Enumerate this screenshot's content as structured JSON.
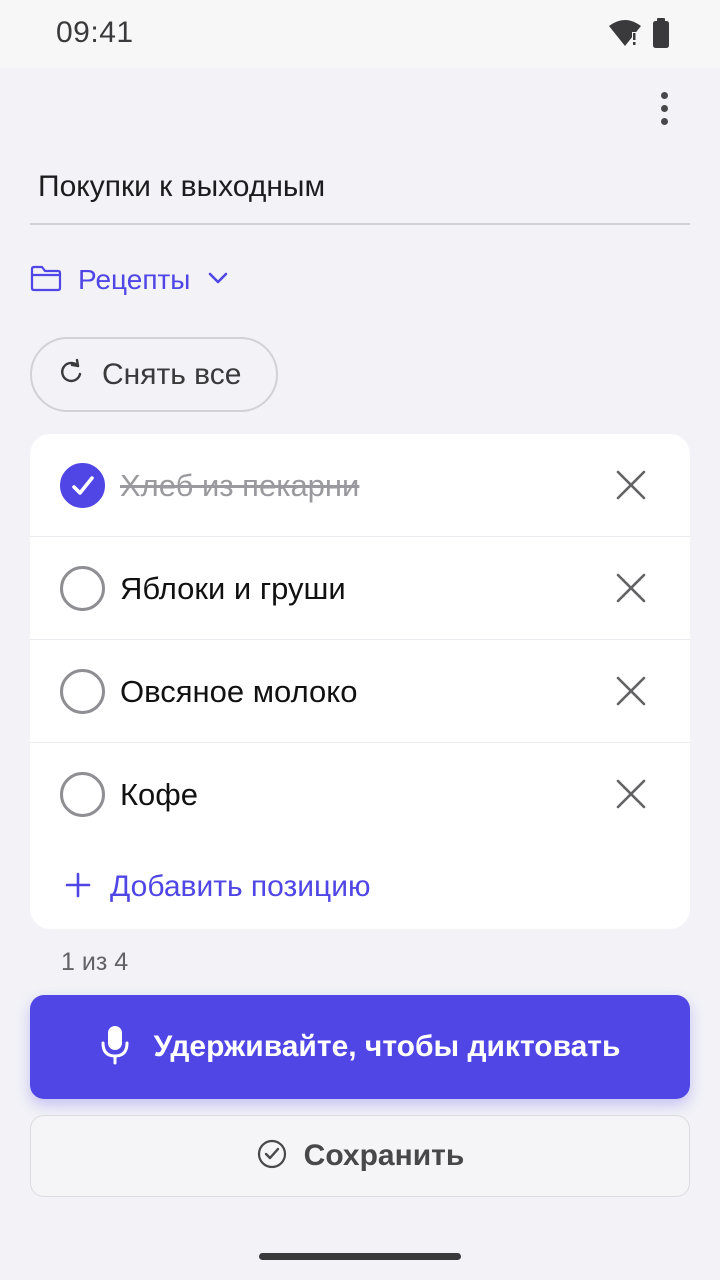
{
  "status_bar": {
    "time": "09:41",
    "icons": [
      "wifi-alert-icon",
      "battery-icon"
    ]
  },
  "toolbar": {
    "overflow_icon": "more-vertical-icon"
  },
  "note": {
    "title": "Покупки к выходным",
    "folder": {
      "icon": "folder-icon",
      "label": "Рецепты",
      "dropdown_icon": "chevron-down-icon"
    }
  },
  "actions": {
    "reset_label": "Снять все",
    "reset_icon": "refresh-icon"
  },
  "checklist": {
    "items": [
      {
        "label": "Хлеб из пекарни",
        "checked": true
      },
      {
        "label": "Яблоки и груши",
        "checked": false
      },
      {
        "label": "Овсяное молоко",
        "checked": false
      },
      {
        "label": "Кофе",
        "checked": false
      }
    ],
    "add_label": "Добавить позицию",
    "counter": "1 из 4"
  },
  "buttons": {
    "dictate_label": "Удерживайте, чтобы диктовать",
    "save_label": "Сохранить"
  },
  "colors": {
    "accent": "#4f46e5",
    "background": "#f2f2f7",
    "card": "#ffffff"
  }
}
